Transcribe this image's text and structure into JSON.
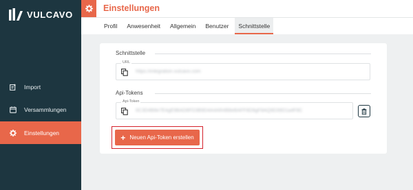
{
  "sidebar": {
    "brand": "VULCAVO",
    "items": [
      {
        "label": "Import",
        "icon": "import-icon"
      },
      {
        "label": "Versammlungen",
        "icon": "calendar-icon"
      },
      {
        "label": "Einstellungen",
        "icon": "gear-icon",
        "active": true
      }
    ]
  },
  "header": {
    "title": "Einstellungen",
    "icon": "gear-icon"
  },
  "tabs": [
    {
      "label": "Profil"
    },
    {
      "label": "Anwesenheit"
    },
    {
      "label": "Allgemein"
    },
    {
      "label": "Benutzer"
    },
    {
      "label": "Schnittstelle",
      "active": true
    }
  ],
  "schnittstelle": {
    "section_title": "Schnittstelle",
    "url_caption": "URL",
    "url_value": "https://integration.vulcavo.com"
  },
  "api_tokens": {
    "section_title": "Api-Tokens",
    "token_caption": "Api-Token",
    "token_value": "0C3D4B8e7E4gE9BAD8FD3B9D4A4AR4B8eBAFF8D9gF8AQ9D39D1a4F8C",
    "add_button_label": "Neuen Api-Token erstellen"
  },
  "colors": {
    "accent": "#e8674a",
    "sidebar_bg": "#1d3640",
    "highlight": "#d4202a"
  }
}
